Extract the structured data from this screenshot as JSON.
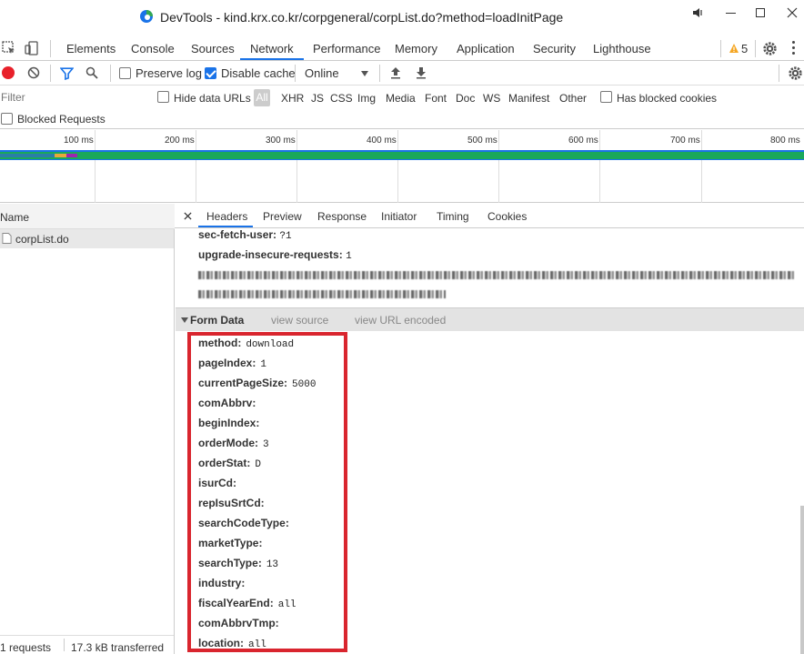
{
  "window": {
    "title": "DevTools - kind.krx.co.kr/corpgeneral/corpList.do?method=loadInitPage"
  },
  "main_tabs": [
    {
      "label": "Elements"
    },
    {
      "label": "Console"
    },
    {
      "label": "Sources"
    },
    {
      "label": "Network",
      "active": true
    },
    {
      "label": "Performance"
    },
    {
      "label": "Memory"
    },
    {
      "label": "Application"
    },
    {
      "label": "Security"
    },
    {
      "label": "Lighthouse"
    }
  ],
  "warning_count": "5",
  "toolbar": {
    "preserve_log": "Preserve log",
    "disable_cache": "Disable cache",
    "throttle": "Online"
  },
  "filter": {
    "placeholder": "Filter",
    "hide_data_urls": "Hide data URLs",
    "all": "All",
    "types": [
      "XHR",
      "JS",
      "CSS",
      "Img",
      "Media",
      "Font",
      "Doc",
      "WS",
      "Manifest",
      "Other"
    ],
    "has_blocked_cookies": "Has blocked cookies",
    "blocked_requests": "Blocked Requests"
  },
  "overview": {
    "ticks": [
      "100 ms",
      "200 ms",
      "300 ms",
      "400 ms",
      "500 ms",
      "600 ms",
      "700 ms",
      "800 ms"
    ],
    "bar_color": "#1aa85b"
  },
  "requests": {
    "name_header": "Name",
    "items": [
      {
        "name": "corpList.do"
      }
    ],
    "status_count": "1 requests",
    "status_transferred": "17.3 kB transferred"
  },
  "detail": {
    "tabs": [
      {
        "label": "Headers",
        "active": true
      },
      {
        "label": "Preview"
      },
      {
        "label": "Response"
      },
      {
        "label": "Initiator"
      },
      {
        "label": "Timing"
      },
      {
        "label": "Cookies"
      }
    ],
    "headers": [
      {
        "key": "sec-fetch-user:",
        "value": "?1"
      },
      {
        "key": "upgrade-insecure-requests:",
        "value": "1"
      }
    ],
    "form_data": {
      "title": "Form Data",
      "view_source": "view source",
      "view_url_encoded": "view URL encoded",
      "rows": [
        {
          "key": "method:",
          "value": "download"
        },
        {
          "key": "pageIndex:",
          "value": "1"
        },
        {
          "key": "currentPageSize:",
          "value": "5000"
        },
        {
          "key": "comAbbrv:",
          "value": ""
        },
        {
          "key": "beginIndex:",
          "value": ""
        },
        {
          "key": "orderMode:",
          "value": "3"
        },
        {
          "key": "orderStat:",
          "value": "D"
        },
        {
          "key": "isurCd:",
          "value": ""
        },
        {
          "key": "repIsuSrtCd:",
          "value": ""
        },
        {
          "key": "searchCodeType:",
          "value": ""
        },
        {
          "key": "marketType:",
          "value": ""
        },
        {
          "key": "searchType:",
          "value": "13"
        },
        {
          "key": "industry:",
          "value": ""
        },
        {
          "key": "fiscalYearEnd:",
          "value": "all"
        },
        {
          "key": "comAbbrvTmp:",
          "value": ""
        },
        {
          "key": "location:",
          "value": "all"
        }
      ]
    }
  },
  "colors": {
    "accent": "#1a73e8",
    "highlight": "#d9252e",
    "record": "#e8202a"
  }
}
